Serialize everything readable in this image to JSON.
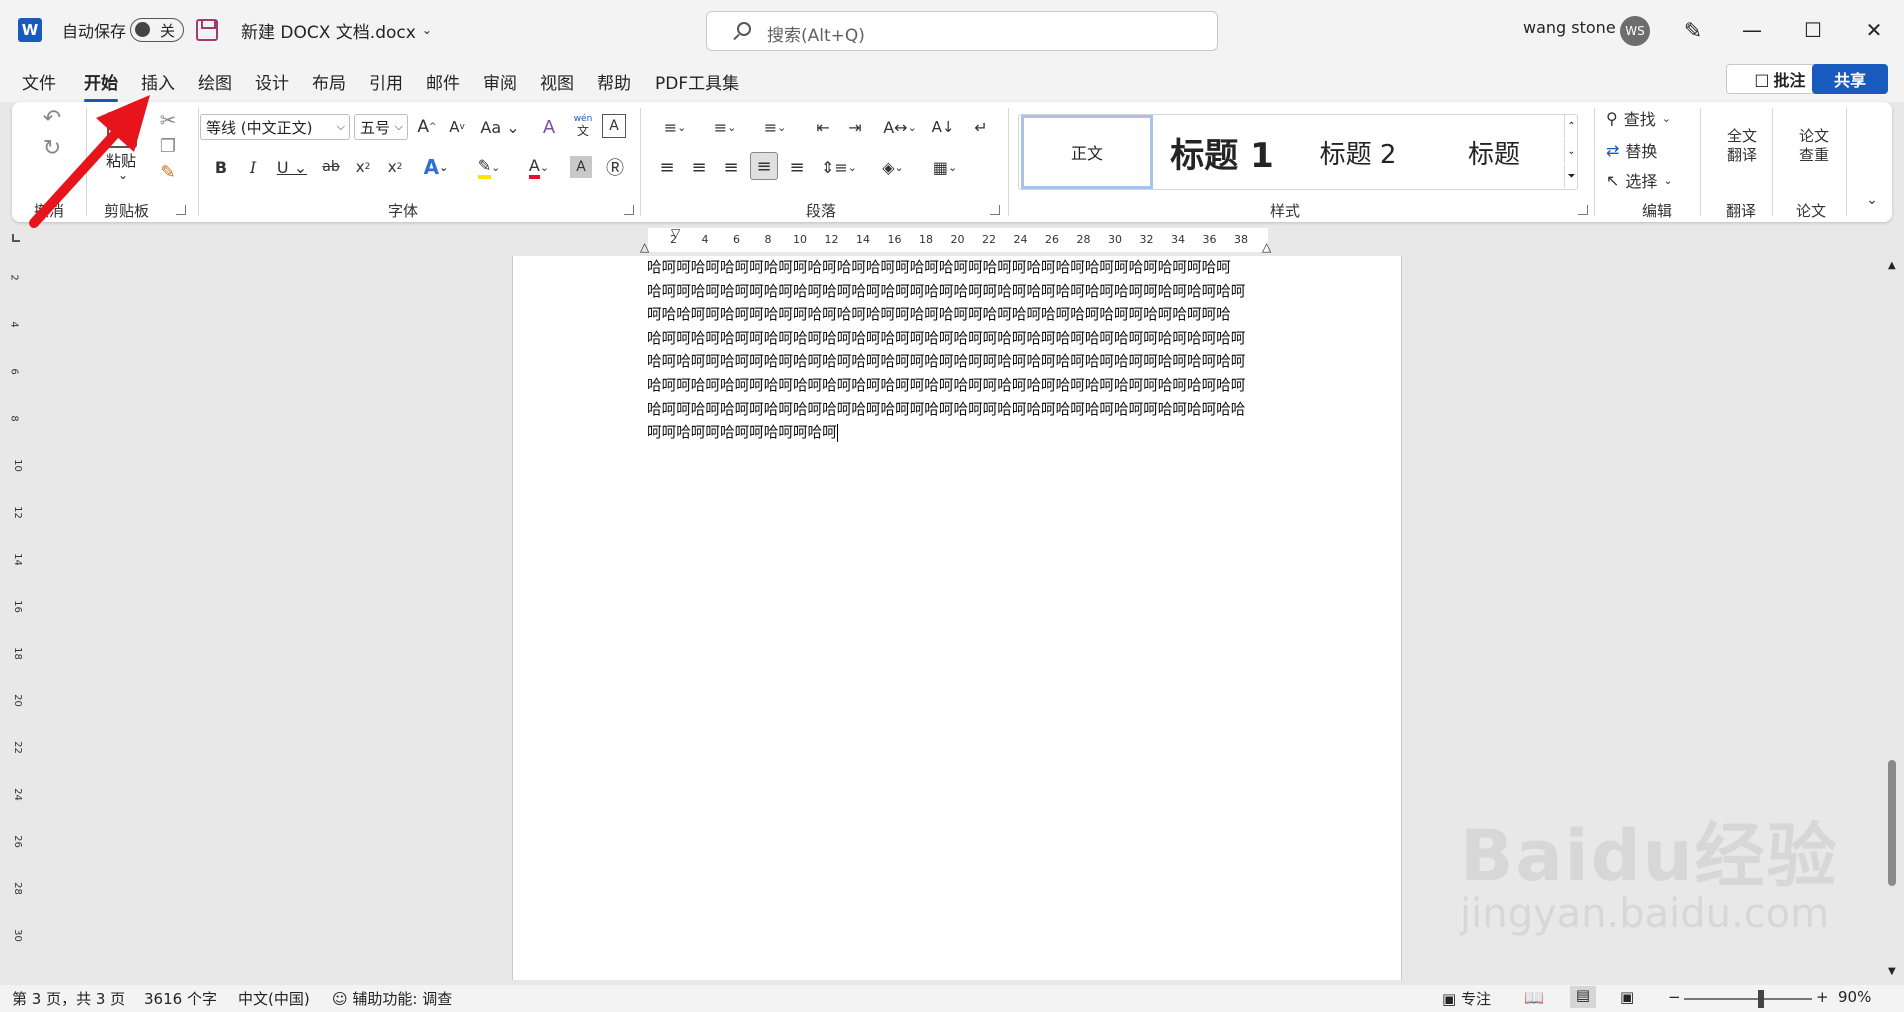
{
  "titlebar": {
    "app_icon": "W",
    "autosave_label": "自动保存",
    "autosave_state": "关",
    "document_title": "新建 DOCX 文档.docx",
    "search_placeholder": "搜索(Alt+Q)",
    "user_name": "wang stone",
    "user_initials": "WS",
    "window_controls": {
      "minimize": "—",
      "maximize": "☐",
      "close": "✕"
    }
  },
  "tabs": [
    "文件",
    "开始",
    "插入",
    "绘图",
    "设计",
    "布局",
    "引用",
    "邮件",
    "审阅",
    "视图",
    "帮助",
    "PDF工具集"
  ],
  "active_tab": "开始",
  "header_buttons": {
    "comment": "批注",
    "share": "共享"
  },
  "ribbon": {
    "undo_group": "撤消",
    "clipboard": {
      "label": "剪贴板",
      "paste": "粘贴"
    },
    "font": {
      "label": "字体",
      "font_name": "等线 (中文正文)",
      "font_size": "五号",
      "phonetic_top": "wén",
      "phonetic_bottom": "文"
    },
    "paragraph": {
      "label": "段落"
    },
    "styles": {
      "label": "样式",
      "items": [
        "正文",
        "标题 1",
        "标题 2",
        "标题"
      ],
      "selected": "正文"
    },
    "editing": {
      "label": "编辑",
      "find": "查找",
      "replace": "替换",
      "select": "选择"
    },
    "translate": {
      "label": "翻译",
      "button_line1": "全文",
      "button_line2": "翻译"
    },
    "paper": {
      "label": "论文",
      "button_line1": "论文",
      "button_line2": "查重"
    }
  },
  "ruler": {
    "horizontal": [
      "2",
      "4",
      "6",
      "8",
      "10",
      "12",
      "14",
      "16",
      "18",
      "20",
      "22",
      "24",
      "26",
      "28",
      "30",
      "32",
      "34",
      "36",
      "38"
    ],
    "vertical": [
      "2",
      "4",
      "6",
      "8",
      "10",
      "12",
      "14",
      "16",
      "18",
      "20",
      "22",
      "24",
      "26",
      "28",
      "30"
    ]
  },
  "document": {
    "lines": [
      "哈呵呵哈呵哈呵呵哈呵呵哈呵哈呵哈呵呵哈呵哈呵呵哈呵呵哈呵哈呵哈呵呵哈呵哈呵呵哈呵",
      "哈呵呵哈呵哈呵呵哈呵哈呵哈呵哈呵哈呵呵哈呵哈呵呵哈呵哈呵哈呵哈呵哈呵呵哈呵哈呵哈呵",
      "呵哈哈呵呵哈呵呵哈呵呵哈呵哈呵哈呵呵哈呵哈呵呵哈呵哈呵哈呵哈呵哈呵呵哈呵哈呵呵哈",
      "哈呵呵哈呵哈呵呵哈呵哈呵哈呵哈呵哈呵呵哈呵哈呵呵哈呵哈呵哈呵哈呵哈呵呵哈呵哈呵哈呵",
      "哈呵哈呵呵哈呵呵哈呵哈呵哈呵哈呵哈呵呵哈呵哈呵呵哈呵哈呵哈呵哈呵哈呵呵哈呵哈呵哈呵",
      "哈呵呵哈呵哈呵呵哈呵哈呵哈呵哈呵哈呵呵哈呵哈呵呵哈呵哈呵哈呵哈呵哈呵呵哈呵哈呵哈呵",
      "哈呵呵哈呵哈呵呵哈呵哈呵哈呵哈呵哈呵呵哈呵哈呵呵哈呵哈呵哈呵哈呵哈呵呵哈呵哈呵哈哈",
      "呵呵哈呵呵哈呵呵哈呵呵哈呵"
    ]
  },
  "statusbar": {
    "page": "第 3 页，共 3 页",
    "words": "3616 个字",
    "language": "中文(中国)",
    "accessibility": "辅助功能: 调查",
    "focus": "专注",
    "zoom": "90%",
    "zoom_level": 0.6
  },
  "watermark": {
    "brand": "Baidu",
    "brand_cn": "经验",
    "url": "jingyan.baidu.com"
  },
  "colors": {
    "accent": "#185abd",
    "arrow": "#e8141c"
  }
}
